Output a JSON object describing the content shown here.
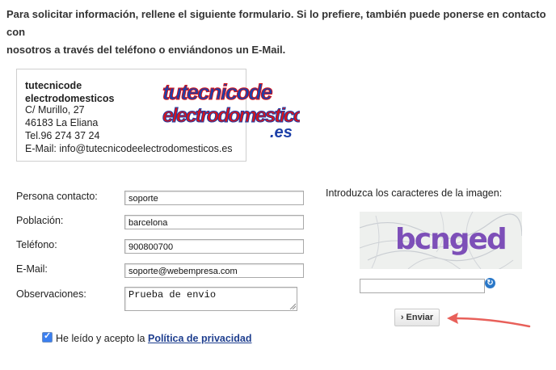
{
  "intro": {
    "line1": "Para solicitar información, rellene el siguiente formulario. Si lo prefiere, también puede ponerse en contacto con",
    "line2": "nosotros  a través del teléfono o enviándonos un E-Mail."
  },
  "company": {
    "name_line1": "tutecnicode",
    "name_line2": "electrodomesticos",
    "address": "C/ Murillo, 27",
    "city": "46183 La Eliana",
    "phone": "Tel.96 274 37 24",
    "email": "E-Mail: info@tutecnicodeelectrodomesticos.es",
    "logo": {
      "line1": "tutecnicode",
      "line2": "electrodomesticos",
      "suffix": ".es"
    }
  },
  "form": {
    "contact_label": "Persona contacto:",
    "contact_value": "soporte",
    "city_label": "Población:",
    "city_value": "barcelona",
    "phone_label": "Teléfono:",
    "phone_value": "900800700",
    "email_label": "E-Mail:",
    "email_value": "soporte@webempresa.com",
    "notes_label": "Observaciones:",
    "notes_value": "Prueba de envio",
    "consent_text": "He leído y acepto la",
    "policy_link": "Política de privacidad"
  },
  "captcha": {
    "label": "Introduzca los caracteres de la imagen:",
    "image_text": "bcnged",
    "input_value": "",
    "refresh_icon": "refresh-icon"
  },
  "submit": {
    "label": "Enviar",
    "icon": "chevron-right-icon"
  },
  "colors": {
    "link": "#1f3f8f",
    "arrow": "#e8605a",
    "logo_blue": "#1c3fa8",
    "logo_red": "#d8141a"
  }
}
